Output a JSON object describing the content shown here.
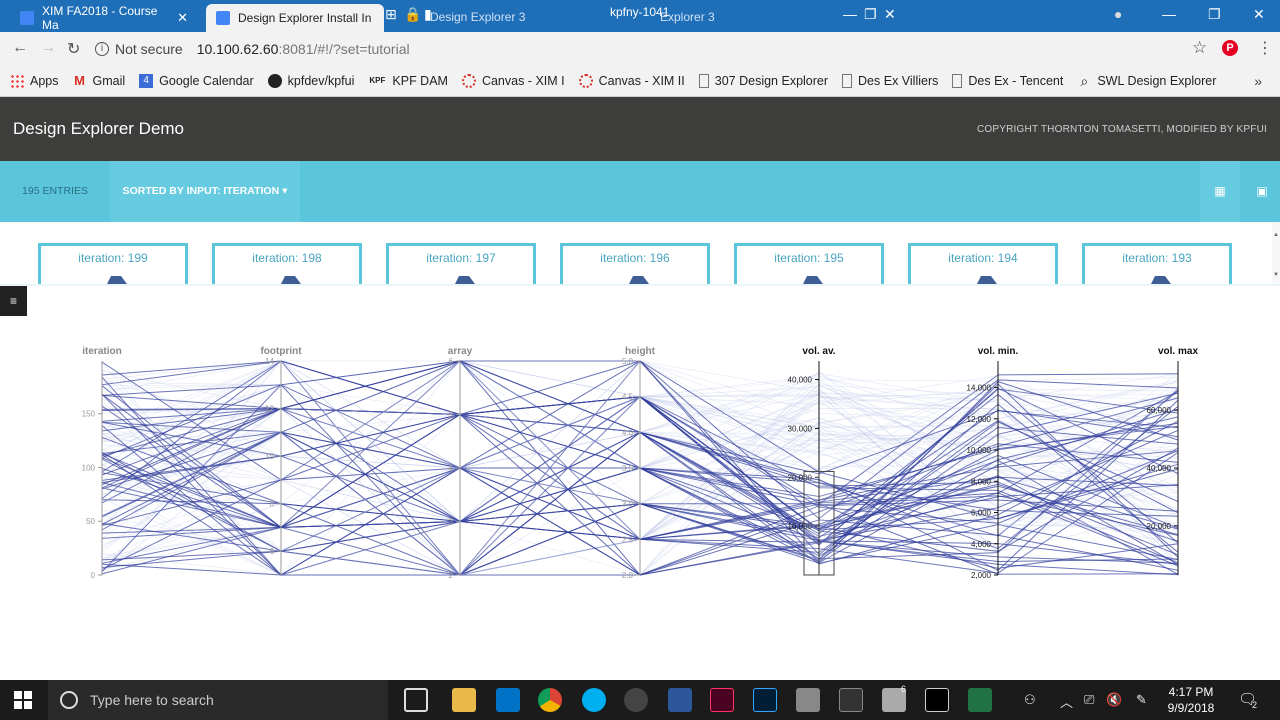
{
  "browser": {
    "tabs": [
      {
        "title": "XIM FA2018 - Course Ma",
        "active": false
      },
      {
        "title": "Design Explorer Install In",
        "active": true
      }
    ],
    "overlay_titles": [
      "Design Explorer 3",
      "kpfny-1041",
      "Explorer 3"
    ],
    "security_label": "Not secure",
    "url_host": "10.100.62.60",
    "url_rest": ":8081/#!/?set=tutorial",
    "bookmarks": [
      {
        "label": "Apps",
        "icon": "apps-grid-icon"
      },
      {
        "label": "Gmail",
        "icon": "gmail-icon"
      },
      {
        "label": "Google Calendar",
        "icon": "calendar-icon"
      },
      {
        "label": "kpfdev/kpfui",
        "icon": "github-icon"
      },
      {
        "label": "KPF DAM",
        "icon": "kpf-icon"
      },
      {
        "label": "Canvas - XIM I",
        "icon": "canvas-icon"
      },
      {
        "label": "Canvas - XIM II",
        "icon": "canvas-icon"
      },
      {
        "label": "307 Design Explorer",
        "icon": "page-icon"
      },
      {
        "label": "Des Ex Villiers",
        "icon": "page-icon"
      },
      {
        "label": "Des Ex - Tencent",
        "icon": "page-icon"
      },
      {
        "label": "SWL Design Explorer",
        "icon": "search-icon"
      }
    ],
    "calendar_day": "4",
    "kpf_text": "KPF",
    "gmail_letter": "M",
    "pinterest_letter": "P"
  },
  "app": {
    "title": "Design Explorer Demo",
    "copyright": "COPYRIGHT THORNTON TOMASETTI, MODIFIED BY KPFUI",
    "entries": "195 ENTRIES",
    "sorted_by": "SORTED BY INPUT: ITERATION"
  },
  "thumbnails": [
    "iteration: 199",
    "iteration: 198",
    "iteration: 197",
    "iteration: 196",
    "iteration: 195",
    "iteration: 194",
    "iteration: 193"
  ],
  "chart_data": {
    "type": "parallel-coordinates",
    "axes": [
      {
        "name": "iteration",
        "ticks": [
          "150",
          "100",
          "50",
          "0"
        ],
        "range": [
          0,
          199
        ],
        "highlighted": false
      },
      {
        "name": "footprint",
        "ticks": [
          "14",
          "12",
          "10",
          "8",
          "6"
        ],
        "range": [
          5,
          14
        ],
        "highlighted": false
      },
      {
        "name": "array",
        "ticks": [
          "6",
          "5",
          "4",
          "3",
          "2"
        ],
        "range": [
          2,
          6
        ],
        "highlighted": false
      },
      {
        "name": "height",
        "ticks": [
          "5.0",
          "4.5",
          "4.0",
          "3.5",
          "3.0",
          "2.5",
          "2.0"
        ],
        "range": [
          2.0,
          5.0
        ],
        "highlighted": false
      },
      {
        "name": "vol. av.",
        "ticks": [
          "40,000",
          "30,000",
          "20,000",
          "10,000"
        ],
        "range": [
          0,
          43800
        ],
        "highlighted": true
      },
      {
        "name": "vol. min.",
        "ticks": [
          "14,000",
          "12,000",
          "10,000",
          "8,000",
          "6,000",
          "4,000",
          "2,000"
        ],
        "range": [
          2000,
          15700
        ],
        "highlighted": true
      },
      {
        "name": "vol. max",
        "ticks": [
          "60,000",
          "40,000",
          "20,000"
        ],
        "range": [
          3000,
          77000
        ],
        "highlighted": true
      }
    ],
    "brush": {
      "axis": "vol. av.",
      "range": [
        0,
        21200
      ]
    }
  },
  "taskbar": {
    "search_placeholder": "Type here to search",
    "time": "4:17 PM",
    "date": "9/9/2018",
    "notifications": "2",
    "rhino_badge": "6"
  }
}
